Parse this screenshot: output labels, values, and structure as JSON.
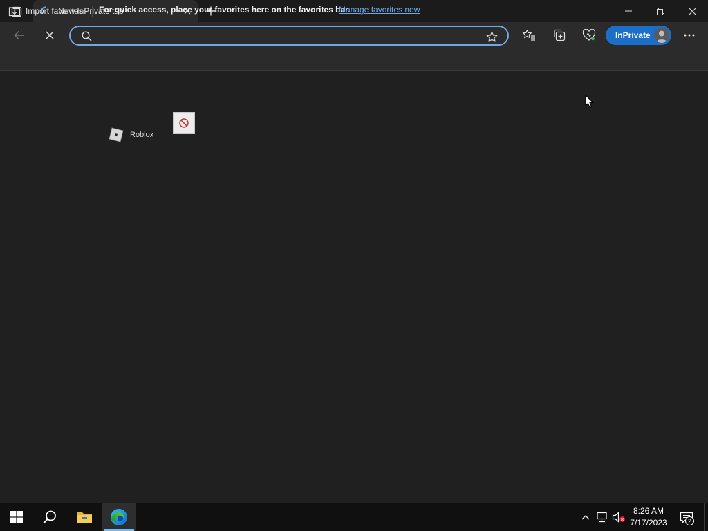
{
  "tab": {
    "title": "New InPrivate tab"
  },
  "addressbar": {
    "value": "",
    "placeholder": ""
  },
  "profile": {
    "inprivate_label": "InPrivate"
  },
  "favorites_bar": {
    "import_label": "Import favorites",
    "hint_text": "For quick access, place your favorites here on the favorites bar.",
    "manage_link": "Manage favorites now"
  },
  "content": {
    "tile_label": "Roblox"
  },
  "taskbar": {
    "time": "8:26 AM",
    "date": "7/17/2023",
    "notification_count": "2",
    "pinned": [
      "start-icon",
      "search-icon",
      "file-explorer-icon",
      "edge-icon"
    ]
  },
  "colors": {
    "accent": "#1b6fc9",
    "link": "#6ea8e6",
    "background": "#202020",
    "toolbar": "#2b2b2b"
  }
}
